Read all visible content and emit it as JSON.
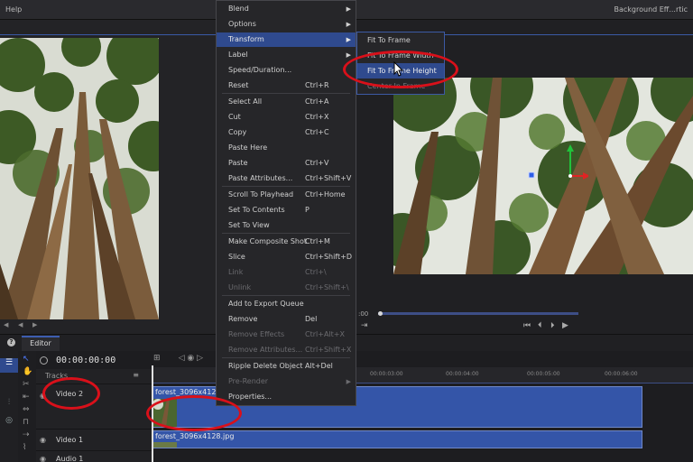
{
  "topbar": {
    "help": "Help",
    "title": "Background Eff...rtic"
  },
  "context_menu": {
    "items": [
      {
        "label": "Blend",
        "shortcut": "",
        "submenu": true,
        "disabled": false,
        "selected": false
      },
      {
        "label": "Options",
        "shortcut": "",
        "submenu": true,
        "disabled": false,
        "selected": false
      },
      {
        "label": "Transform",
        "shortcut": "",
        "submenu": true,
        "disabled": false,
        "selected": true
      },
      {
        "label": "Label",
        "shortcut": "",
        "submenu": true,
        "disabled": false,
        "selected": false
      },
      {
        "label": "Speed/Duration...",
        "shortcut": "",
        "submenu": false,
        "disabled": false,
        "selected": false
      },
      {
        "label": "Reset",
        "shortcut": "Ctrl+R",
        "submenu": false,
        "disabled": false,
        "selected": false
      },
      {
        "label": "Select All",
        "shortcut": "Ctrl+A",
        "submenu": false,
        "disabled": false,
        "selected": false
      },
      {
        "label": "Cut",
        "shortcut": "Ctrl+X",
        "submenu": false,
        "disabled": false,
        "selected": false
      },
      {
        "label": "Copy",
        "shortcut": "Ctrl+C",
        "submenu": false,
        "disabled": false,
        "selected": false
      },
      {
        "label": "Paste Here",
        "shortcut": "",
        "submenu": false,
        "disabled": false,
        "selected": false
      },
      {
        "label": "Paste",
        "shortcut": "Ctrl+V",
        "submenu": false,
        "disabled": false,
        "selected": false
      },
      {
        "label": "Paste Attributes...",
        "shortcut": "Ctrl+Shift+V",
        "submenu": false,
        "disabled": false,
        "selected": false
      },
      {
        "label": "Scroll To Playhead",
        "shortcut": "Ctrl+Home",
        "submenu": false,
        "disabled": false,
        "selected": false
      },
      {
        "label": "Set To Contents",
        "shortcut": "P",
        "submenu": false,
        "disabled": false,
        "selected": false
      },
      {
        "label": "Set To View",
        "shortcut": "",
        "submenu": false,
        "disabled": false,
        "selected": false
      },
      {
        "label": "Make Composite Shot",
        "shortcut": "Ctrl+M",
        "submenu": false,
        "disabled": false,
        "selected": false
      },
      {
        "label": "Slice",
        "shortcut": "Ctrl+Shift+D",
        "submenu": false,
        "disabled": false,
        "selected": false
      },
      {
        "label": "Link",
        "shortcut": "Ctrl+\\",
        "submenu": false,
        "disabled": true,
        "selected": false
      },
      {
        "label": "Unlink",
        "shortcut": "Ctrl+Shift+\\",
        "submenu": false,
        "disabled": true,
        "selected": false
      },
      {
        "label": "Add to Export Queue",
        "shortcut": "",
        "submenu": false,
        "disabled": false,
        "selected": false
      },
      {
        "label": "Remove",
        "shortcut": "Del",
        "submenu": false,
        "disabled": false,
        "selected": false
      },
      {
        "label": "Remove Effects",
        "shortcut": "Ctrl+Alt+X",
        "submenu": false,
        "disabled": true,
        "selected": false
      },
      {
        "label": "Remove Attributes...",
        "shortcut": "Ctrl+Shift+X",
        "submenu": false,
        "disabled": true,
        "selected": false
      },
      {
        "label": "Ripple Delete Object",
        "shortcut": "Alt+Del",
        "submenu": false,
        "disabled": false,
        "selected": false
      },
      {
        "label": "Pre-Render",
        "shortcut": "",
        "submenu": true,
        "disabled": true,
        "selected": false
      },
      {
        "label": "Properties...",
        "shortcut": "",
        "submenu": false,
        "disabled": false,
        "selected": false
      }
    ]
  },
  "transform_submenu": {
    "items": [
      {
        "label": "Fit To Frame",
        "selected": false,
        "disabled": false
      },
      {
        "label": "Fit To Frame Width",
        "selected": false,
        "disabled": false
      },
      {
        "label": "Fit To Frame Height",
        "selected": true,
        "disabled": false
      },
      {
        "label": "Center In Frame",
        "selected": false,
        "disabled": true
      }
    ]
  },
  "program": {
    "timecode": ":00"
  },
  "editor": {
    "tab": "Editor",
    "help": "?",
    "timecode": "00:00:00:00",
    "tracks_label": "Tracks",
    "ruler_ticks": [
      "00:00:03:00",
      "00:00:04:00",
      "00:00:05:00",
      "00:00:06:00"
    ],
    "tracks": [
      {
        "name": "Video 2",
        "clip": "forest_3096x4128"
      },
      {
        "name": "Video 1",
        "clip": "forest_3096x4128.jpg"
      },
      {
        "name": "Audio 1",
        "clip": ""
      }
    ]
  },
  "colors": {
    "accent": "#2f4a8e",
    "annotation": "#d9101a",
    "clip": "#3455a8"
  }
}
